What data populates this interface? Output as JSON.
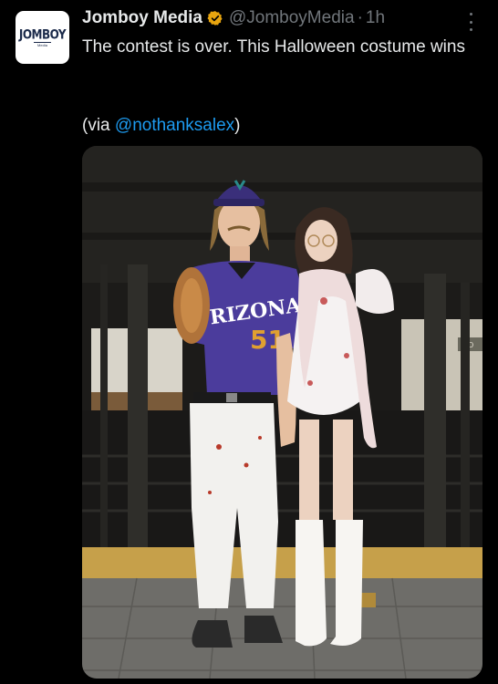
{
  "tweet": {
    "author_name": "Jomboy Media",
    "handle": "@JomboyMedia",
    "separator": "·",
    "time": "1h",
    "text": "The contest is over. This Halloween costume wins",
    "via_prefix": "(via ",
    "via_mention": "@nothanksalex",
    "via_suffix": ")",
    "avatar_logo": "JOMBOY",
    "avatar_tagline": "Media"
  },
  "photo": {
    "jersey_text": "RIZONA",
    "jersey_number": "51",
    "sign_text": "ICO"
  },
  "icons": [
    "verified-badge-icon",
    "more-options-icon"
  ],
  "colors": {
    "background": "#000000",
    "text": "#e7e9ea",
    "muted": "#71767b",
    "link": "#1d9bf0",
    "badge": "#e8a50f"
  }
}
